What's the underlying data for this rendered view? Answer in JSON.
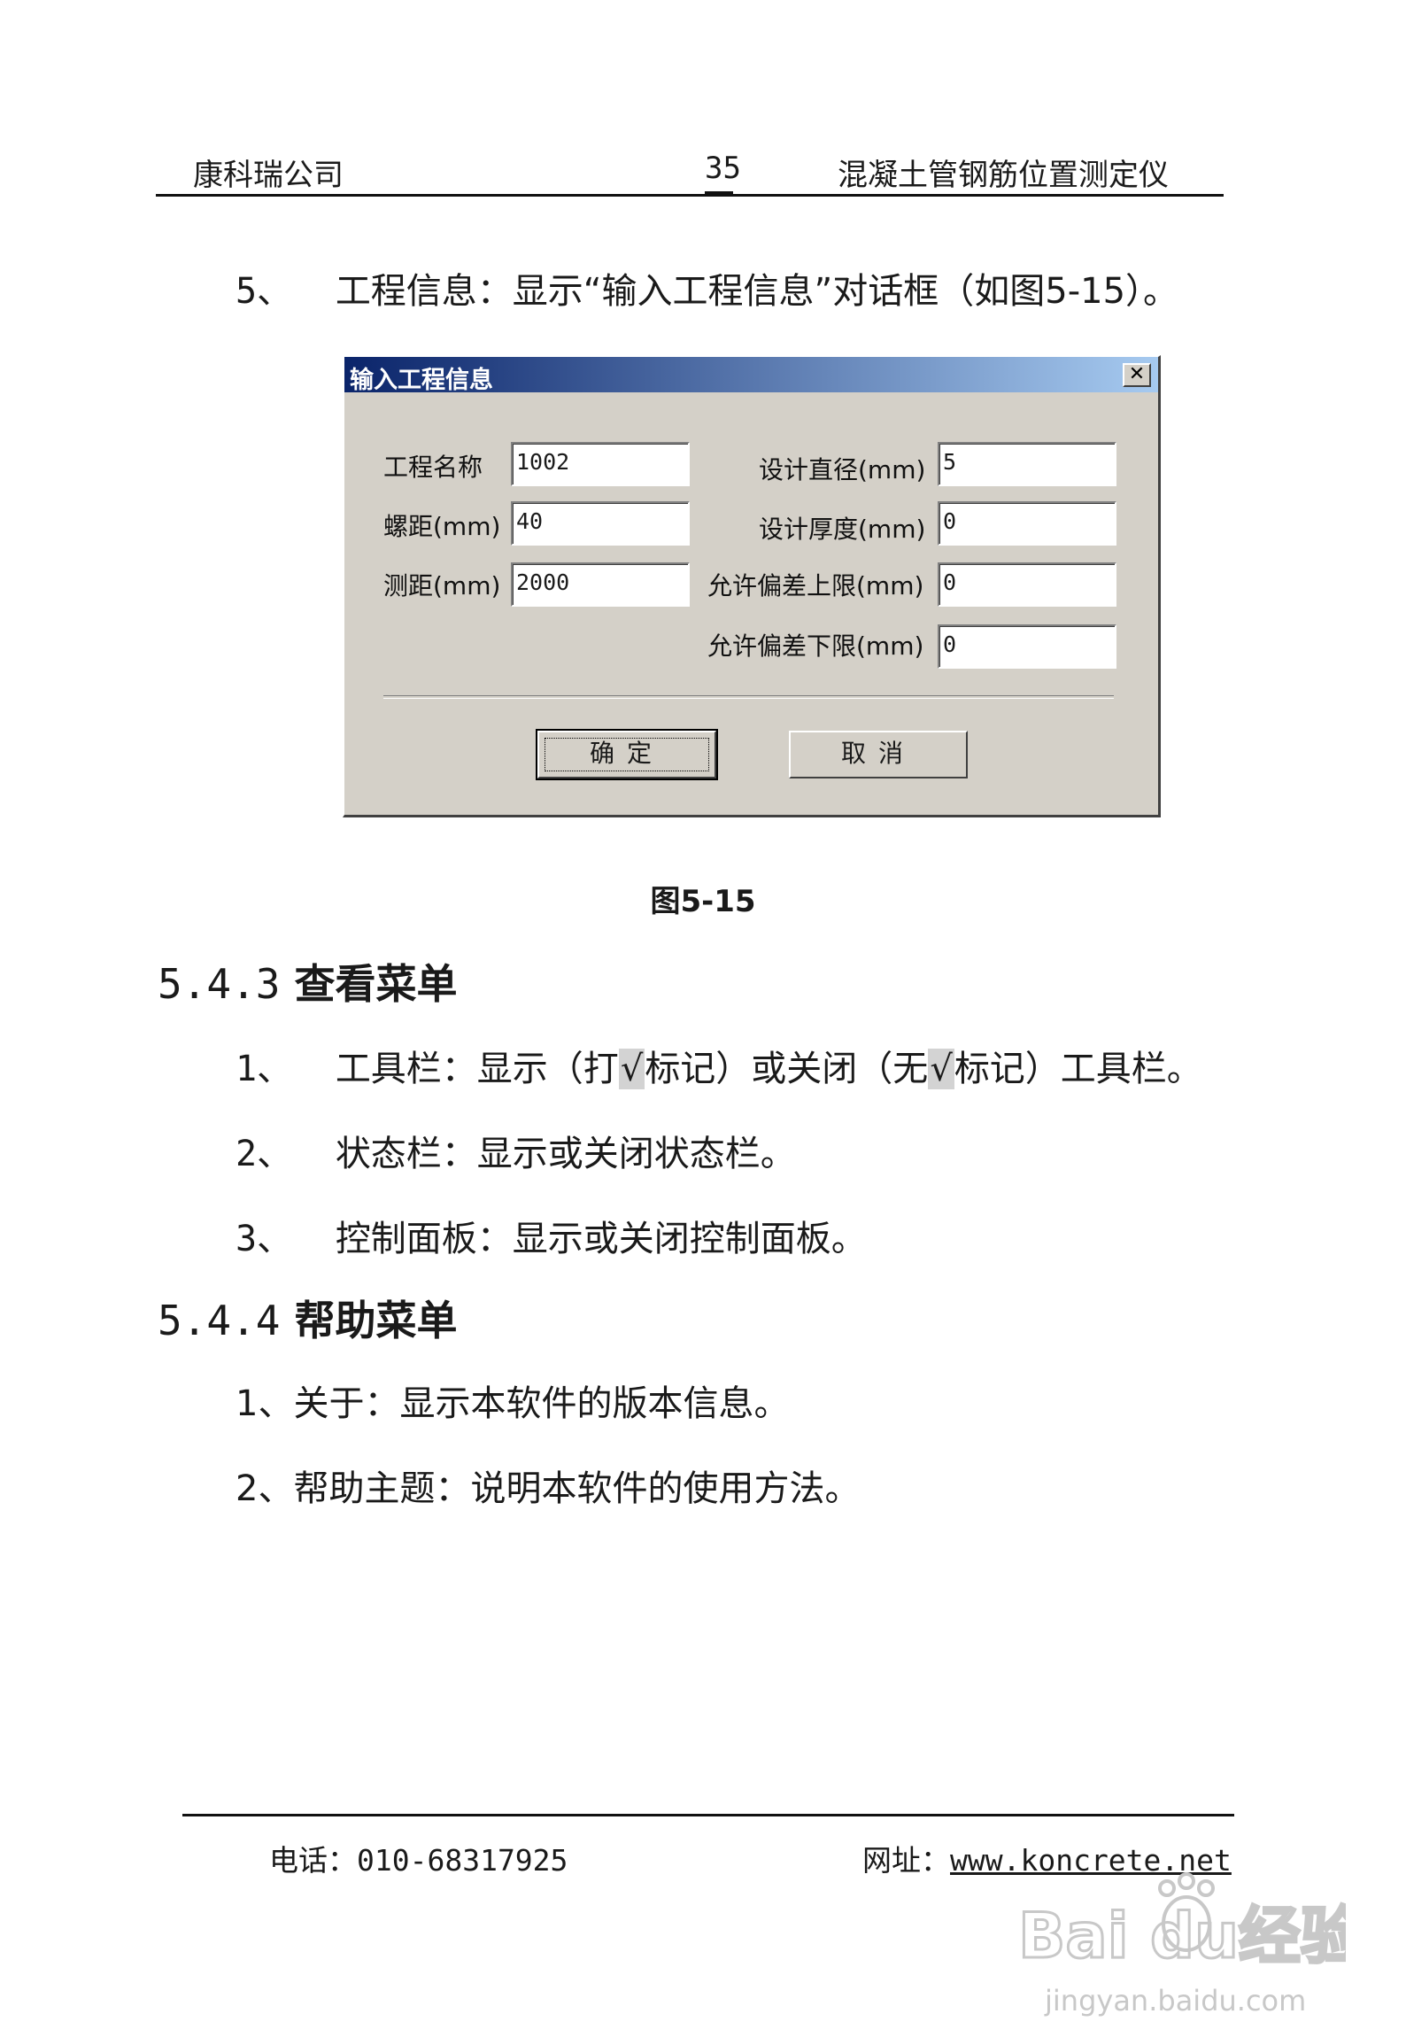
{
  "header": {
    "company": "康科瑞公司",
    "page_number": "35",
    "product": "混凝土管钢筋位置测定仪"
  },
  "intro_item": {
    "number": "5、",
    "text": "工程信息：显示“输入工程信息”对话框（如图5-15）。"
  },
  "dialog": {
    "title": "输入工程信息",
    "close_label": "✕",
    "fields": {
      "project_name": {
        "label": "工程名称",
        "value": "1002"
      },
      "pitch": {
        "label": "螺距(mm)",
        "value": "40"
      },
      "measure_distance": {
        "label": "测距(mm)",
        "value": "2000"
      },
      "design_diameter": {
        "label": "设计直径(mm)",
        "value": "5"
      },
      "design_thickness": {
        "label": "设计厚度(mm)",
        "value": "0"
      },
      "tolerance_upper": {
        "label": "允许偏差上限(mm)",
        "value": "0"
      },
      "tolerance_lower": {
        "label": "允许偏差下限(mm)",
        "value": "0"
      }
    },
    "ok_label": "确定",
    "cancel_label": "取消"
  },
  "figure_caption": "图5-15",
  "section_view": {
    "heading_number": "5.4.3",
    "heading_text": "查看菜单",
    "items": [
      {
        "number": "1、",
        "text_a": "工具栏：显示（打",
        "check": "√",
        "text_b": "标记）或关闭（无",
        "text_c": "标记）工具栏。"
      },
      {
        "number": "2、",
        "text": "状态栏：显示或关闭状态栏。"
      },
      {
        "number": "3、",
        "text": "控制面板：显示或关闭控制面板。"
      }
    ]
  },
  "section_help": {
    "heading_number": "5.4.4",
    "heading_text": "帮助菜单",
    "items": [
      {
        "text": "1、关于：显示本软件的版本信息。"
      },
      {
        "text": "2、帮助主题：说明本软件的使用方法。"
      }
    ]
  },
  "footer": {
    "phone_label": "电话：",
    "phone": "010-68317925",
    "site_label": "网址：",
    "site": "www.koncrete.net"
  },
  "watermark": {
    "brand": "Baidu经验",
    "url": "jingyan.baidu.com"
  }
}
